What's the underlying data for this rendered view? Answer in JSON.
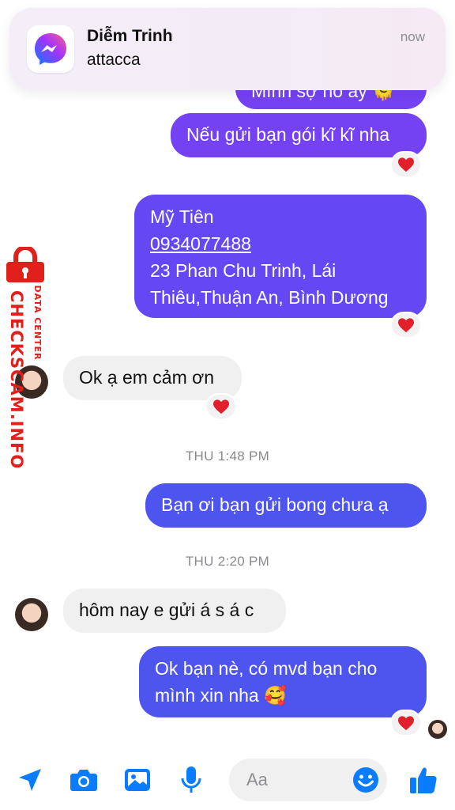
{
  "notification": {
    "sender": "Diễm Trinh",
    "message": "attacca",
    "time": "now"
  },
  "messages": [
    {
      "direction": "outgoing",
      "text": "Mình sợ nó ấy 🫠"
    },
    {
      "direction": "outgoing",
      "text": "Nếu gửi bạn gói kĩ kĩ nha",
      "reaction": "❤️"
    },
    {
      "direction": "outgoing",
      "lines": [
        "Mỹ Tiên",
        "0934077488",
        "23 Phan Chu Trinh, Lái",
        "Thiêu,Thuận An, Bình Dương"
      ],
      "reaction": "❤️"
    },
    {
      "direction": "incoming",
      "text": "Ok ạ em cảm ơn",
      "reaction": "❤️"
    },
    {
      "divider": "THU 1:48 PM"
    },
    {
      "direction": "outgoing",
      "text": "Bạn ơi bạn gửi bong chưa ạ"
    },
    {
      "divider": "THU 2:20 PM"
    },
    {
      "direction": "incoming",
      "text": "hôm nay e gửi á s á c"
    },
    {
      "direction": "outgoing",
      "lines": [
        "Ok bạn nè, có mvd bạn cho",
        "mình xin nha 🥰"
      ],
      "reaction": "❤️"
    }
  ],
  "watermark": {
    "main": "CHECKSCAM.INFO",
    "sub": "DATA CENTER"
  },
  "composer": {
    "placeholder": "Aa",
    "icons": [
      "send-arrow-icon",
      "camera-icon",
      "gallery-icon",
      "microphone-icon",
      "emoji-icon",
      "thumbs-up-icon"
    ]
  },
  "colors": {
    "messenger_blue": "#0a7cff",
    "bubble_purple": "#7442f2",
    "bubble_violet": "#6548f3",
    "bubble_blue": "#4e54ee",
    "incoming_gray": "#f0f0f0",
    "watermark_red": "#e0201b"
  }
}
